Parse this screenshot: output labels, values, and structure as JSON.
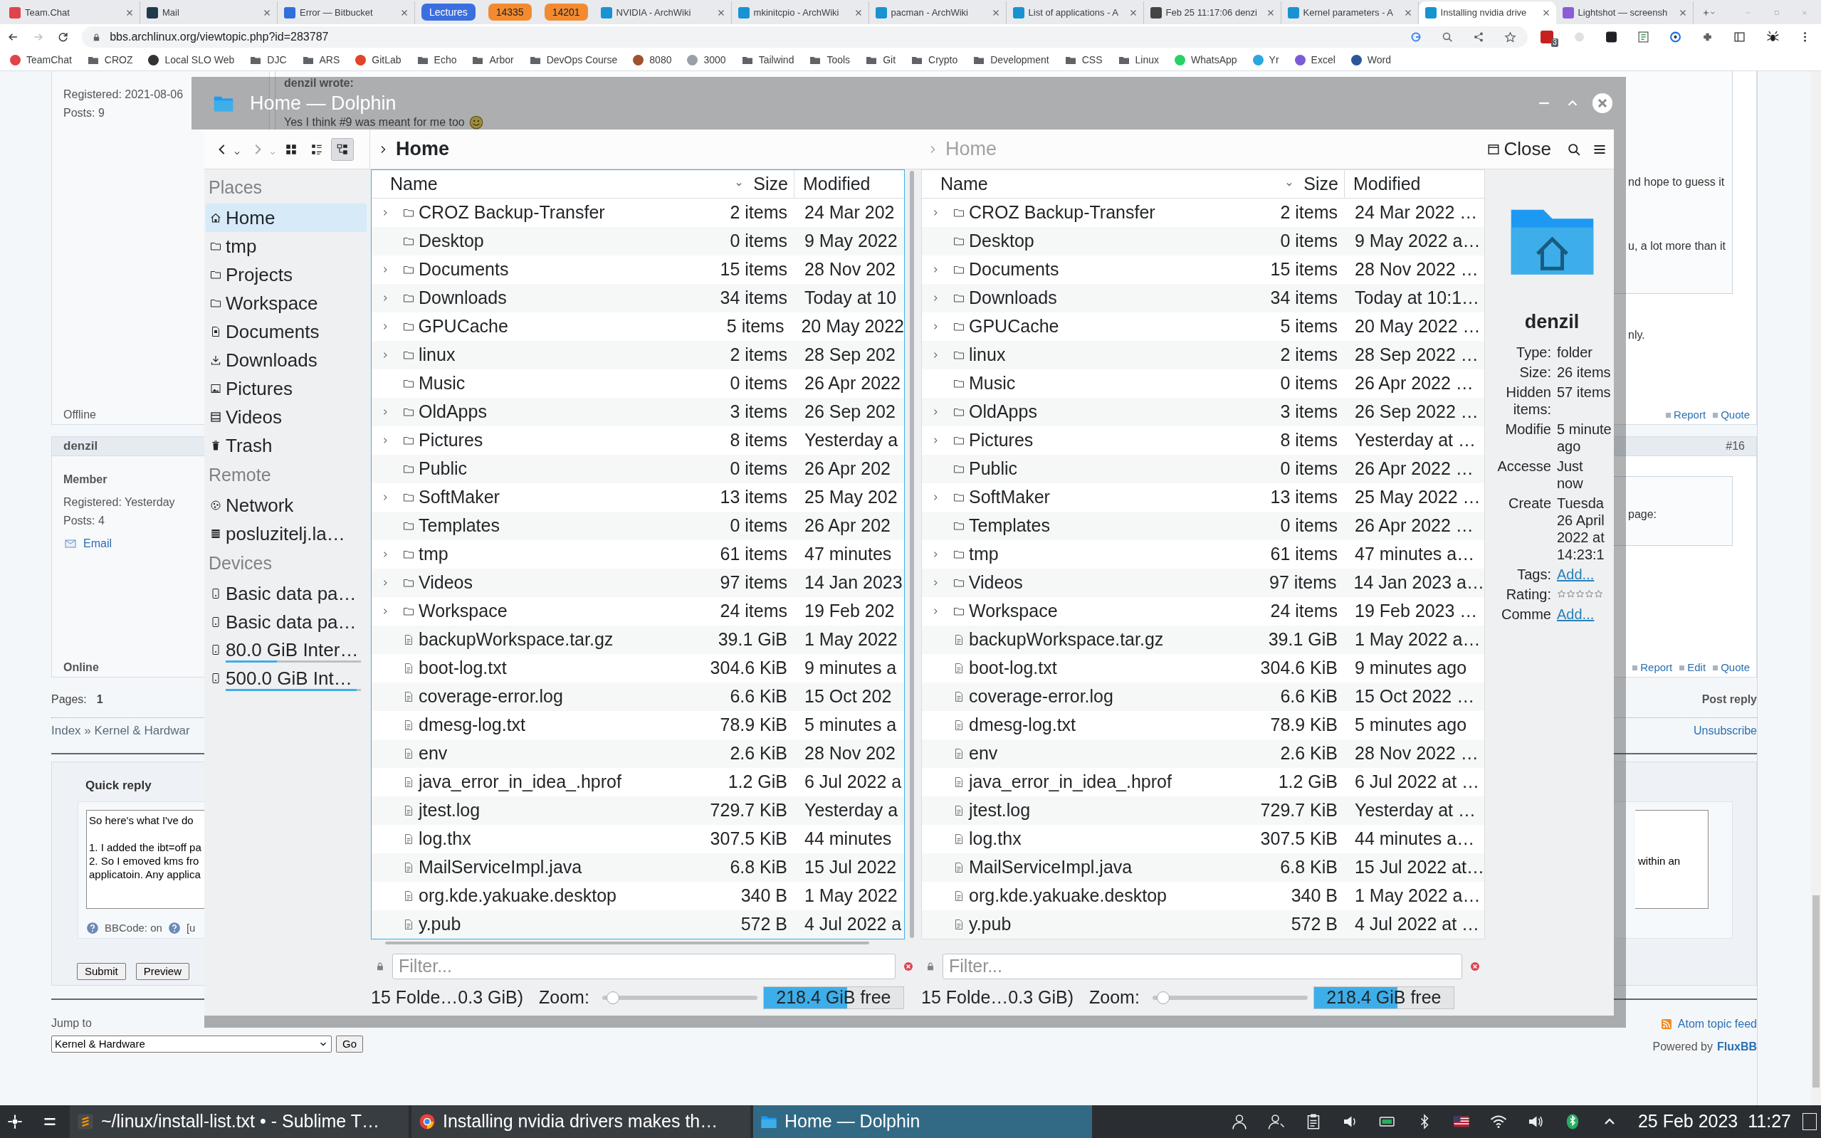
{
  "browser": {
    "tabs": [
      {
        "title": "Team.Chat",
        "kind": "tab",
        "color": "#e0434b",
        "selected": false
      },
      {
        "title": "Mail",
        "kind": "tab",
        "color": "#1f3a4d",
        "selected": false
      },
      {
        "title": "Error — Bitbucket",
        "kind": "tab",
        "color": "#2f6fdb",
        "selected": false
      },
      {
        "title": "Lectures",
        "kind": "group",
        "color": "#3b6fe0"
      },
      {
        "title": "14335",
        "kind": "group",
        "color": "#f28b30"
      },
      {
        "title": "14201",
        "kind": "group",
        "color": "#f28b30"
      },
      {
        "title": "NVIDIA - ArchWiki",
        "kind": "tab",
        "color": "#1793d1",
        "selected": false
      },
      {
        "title": "mkinitcpio - ArchWiki",
        "kind": "tab",
        "color": "#1793d1",
        "selected": false
      },
      {
        "title": "pacman - ArchWiki",
        "kind": "tab",
        "color": "#1793d1",
        "selected": false
      },
      {
        "title": "List of applications - A",
        "kind": "tab",
        "color": "#1793d1",
        "selected": false
      },
      {
        "title": "Feb 25 11:17:06 denzi",
        "kind": "tab",
        "color": "#444444",
        "selected": false
      },
      {
        "title": "Kernel parameters - A",
        "kind": "tab",
        "color": "#1793d1",
        "selected": false
      },
      {
        "title": "Installing nvidia drive",
        "kind": "tab",
        "color": "#1793d1",
        "selected": true
      },
      {
        "title": "Lightshot — screensh",
        "kind": "tab",
        "color": "#8a5cd6",
        "selected": false
      }
    ],
    "address": "bbs.archlinux.org/viewtopic.php?id=283787",
    "extension_badge": "3",
    "bookmarks": [
      {
        "label": "TeamChat",
        "kind": "site",
        "color": "#e0434b"
      },
      {
        "label": "CROZ",
        "kind": "folder"
      },
      {
        "label": "Local SLO Web",
        "kind": "site",
        "color": "#333333"
      },
      {
        "label": "DJC",
        "kind": "folder"
      },
      {
        "label": "ARS",
        "kind": "folder"
      },
      {
        "label": "GitLab",
        "kind": "site",
        "color": "#e24329"
      },
      {
        "label": "Echo",
        "kind": "folder"
      },
      {
        "label": "Arbor",
        "kind": "folder"
      },
      {
        "label": "DevOps Course",
        "kind": "folder"
      },
      {
        "label": "8080",
        "kind": "site",
        "color": "#a0522d"
      },
      {
        "label": "3000",
        "kind": "site",
        "color": "#9aa0a6"
      },
      {
        "label": "Tailwind",
        "kind": "folder"
      },
      {
        "label": "Tools",
        "kind": "folder"
      },
      {
        "label": "Git",
        "kind": "folder"
      },
      {
        "label": "Crypto",
        "kind": "folder"
      },
      {
        "label": "Development",
        "kind": "folder"
      },
      {
        "label": "CSS",
        "kind": "folder"
      },
      {
        "label": "Linux",
        "kind": "folder"
      },
      {
        "label": "WhatsApp",
        "kind": "site",
        "color": "#25d366"
      },
      {
        "label": "Yr",
        "kind": "site",
        "color": "#2aa7e0"
      },
      {
        "label": "Excel",
        "kind": "site",
        "color": "#7b5cd6"
      },
      {
        "label": "Word",
        "kind": "site",
        "color": "#2b579a"
      }
    ]
  },
  "forum": {
    "post1": {
      "registered": "Registered: 2021-08-06",
      "posts": "Posts: 9",
      "status": "Offline",
      "quote_author": "denzil wrote:",
      "quote_text": "Yes I think #9 was meant for me too",
      "quote_tail": [
        "nd hope to guess it",
        "u, a lot more than it"
      ],
      "tail": "nly.",
      "actions": [
        "Report",
        "Quote"
      ]
    },
    "post2": {
      "author": "denzil",
      "number": "#16",
      "rank": "Member",
      "registered": "Registered: Yesterday",
      "posts": "Posts: 4",
      "email": "Email",
      "quote_tail": "page:",
      "status": "Online",
      "actions": [
        "Report",
        "Edit",
        "Quote"
      ]
    },
    "pages_label": "Pages:",
    "page": "1",
    "post_reply": "Post reply",
    "breadcrumb": "Index » Kernel & Hardwar",
    "unsubscribe": "Unsubscribe",
    "quick_reply": {
      "title": "Quick reply",
      "paragraphs": [
        [
          {
            "text": "So here's what I've do"
          }
        ],
        [
          {
            "text": "1. I added the ibt=off pa"
          },
          {
            "text": "2. So I emoved kms fro",
            "end": "within an"
          },
          {
            "text": "applicatoin. Any applica"
          }
        ]
      ],
      "bbcode": "BBCode: on",
      "bbcode_2": "[u",
      "buttons": [
        "Submit",
        "Preview"
      ]
    },
    "jump_label": "Jump to",
    "jump_value": "Kernel & Hardware",
    "go": "Go",
    "feed": "Atom topic feed",
    "powered": "Powered by",
    "powered_link": "FluxBB"
  },
  "dolphin": {
    "title": "Home — Dolphin",
    "view_modes": [
      {
        "selected": false
      },
      {
        "selected": false
      },
      {
        "selected": true
      }
    ],
    "close": "Close",
    "places": [
      {
        "heading": "Places",
        "items": [
          {
            "label": "Home",
            "selected": true
          },
          {
            "label": "tmp",
            "selected": false
          },
          {
            "label": "Projects",
            "selected": false
          },
          {
            "label": "Workspace",
            "selected": false
          },
          {
            "label": "Documents",
            "selected": false
          },
          {
            "label": "Downloads",
            "selected": false
          },
          {
            "label": "Pictures",
            "selected": false
          },
          {
            "label": "Videos",
            "selected": false
          },
          {
            "label": "Trash",
            "selected": false
          }
        ]
      },
      {
        "heading": "Remote",
        "items": [
          {
            "label": "Network",
            "selected": false
          },
          {
            "label": "posluzitelj.la…",
            "selected": false
          }
        ]
      },
      {
        "heading": "Devices",
        "items": [
          {
            "label": "Basic data pa…",
            "selected": false
          },
          {
            "label": "Basic data pa…",
            "selected": false
          },
          {
            "label": "80.0 GiB Inter…",
            "selected": false,
            "level": 0.38
          },
          {
            "label": "500.0 GiB Int…",
            "selected": false,
            "level": 0.97
          }
        ]
      }
    ],
    "panes": [
      {
        "breadcrumb": "Home",
        "active": true,
        "columns": [
          {
            "label": "Name",
            "sorted": false
          },
          {
            "label": "Size",
            "sorted": true
          },
          {
            "label": "Modified",
            "sorted": false
          }
        ],
        "rows": [
          {
            "name": "CROZ Backup-Transfer",
            "size": "2 items",
            "modified": "24 Mar 202",
            "kind": "folder",
            "expandable": true
          },
          {
            "name": "Desktop",
            "size": "0 items",
            "modified": "9 May 2022",
            "kind": "folder",
            "expandable": false
          },
          {
            "name": "Documents",
            "size": "15 items",
            "modified": "28 Nov 202",
            "kind": "folder",
            "expandable": true
          },
          {
            "name": "Downloads",
            "size": "34 items",
            "modified": "Today at 10",
            "kind": "folder",
            "expandable": true
          },
          {
            "name": "GPUCache",
            "size": "5 items",
            "modified": "20 May 2022",
            "kind": "folder",
            "expandable": true
          },
          {
            "name": "linux",
            "size": "2 items",
            "modified": "28 Sep 202",
            "kind": "folder",
            "expandable": true
          },
          {
            "name": "Music",
            "size": "0 items",
            "modified": "26 Apr 2022",
            "kind": "folder",
            "expandable": false
          },
          {
            "name": "OldApps",
            "size": "3 items",
            "modified": "26 Sep 202",
            "kind": "folder",
            "expandable": true
          },
          {
            "name": "Pictures",
            "size": "8 items",
            "modified": "Yesterday a",
            "kind": "folder",
            "expandable": true
          },
          {
            "name": "Public",
            "size": "0 items",
            "modified": "26 Apr 202",
            "kind": "folder",
            "expandable": false
          },
          {
            "name": "SoftMaker",
            "size": "13 items",
            "modified": "25 May 202",
            "kind": "folder",
            "expandable": true
          },
          {
            "name": "Templates",
            "size": "0 items",
            "modified": "26 Apr 202",
            "kind": "folder",
            "expandable": false
          },
          {
            "name": "tmp",
            "size": "61 items",
            "modified": "47 minutes",
            "kind": "folder",
            "expandable": true
          },
          {
            "name": "Videos",
            "size": "97 items",
            "modified": "14 Jan 2023",
            "kind": "folder",
            "expandable": true
          },
          {
            "name": "Workspace",
            "size": "24 items",
            "modified": "19 Feb 202",
            "kind": "folder",
            "expandable": true
          },
          {
            "name": "backupWorkspace.tar.gz",
            "size": "39.1 GiB",
            "modified": "1 May 2022",
            "kind": "file",
            "expandable": false
          },
          {
            "name": "boot-log.txt",
            "size": "304.6 KiB",
            "modified": "9 minutes a",
            "kind": "file",
            "expandable": false
          },
          {
            "name": "coverage-error.log",
            "size": "6.6 KiB",
            "modified": "15 Oct 202",
            "kind": "file",
            "expandable": false
          },
          {
            "name": "dmesg-log.txt",
            "size": "78.9 KiB",
            "modified": "5 minutes a",
            "kind": "file",
            "expandable": false
          },
          {
            "name": "env",
            "size": "2.6 KiB",
            "modified": "28 Nov 202",
            "kind": "file",
            "expandable": false
          },
          {
            "name": "java_error_in_idea_.hprof",
            "size": "1.2 GiB",
            "modified": "6 Jul 2022 a",
            "kind": "file",
            "expandable": false
          },
          {
            "name": "jtest.log",
            "size": "729.7 KiB",
            "modified": "Yesterday a",
            "kind": "file",
            "expandable": false
          },
          {
            "name": "log.thx",
            "size": "307.5 KiB",
            "modified": "44 minutes",
            "kind": "file",
            "expandable": false
          },
          {
            "name": "MailServiceImpl.java",
            "size": "6.8 KiB",
            "modified": "15 Jul 2022",
            "kind": "file",
            "expandable": false
          },
          {
            "name": "org.kde.yakuake.desktop",
            "size": "340 B",
            "modified": "1 May 2022",
            "kind": "file",
            "expandable": false
          },
          {
            "name": "y.pub",
            "size": "572 B",
            "modified": "4 Jul 2022 a",
            "kind": "file",
            "expandable": false
          }
        ],
        "filter_placeholder": "Filter...",
        "summary": "15 Folde…0.3 GiB)",
        "zoom": {
          "label": "Zoom:",
          "level": 0.03
        },
        "free": {
          "text": "218.4 GiB free",
          "level": 0.6
        }
      },
      {
        "breadcrumb": "Home",
        "active": false,
        "columns": [
          {
            "label": "Name",
            "sorted": false
          },
          {
            "label": "Size",
            "sorted": true
          },
          {
            "label": "Modified",
            "sorted": false
          }
        ],
        "rows": [
          {
            "name": "CROZ Backup-Transfer",
            "size": "2 items",
            "modified": "24 Mar 2022 …",
            "kind": "folder",
            "expandable": true
          },
          {
            "name": "Desktop",
            "size": "0 items",
            "modified": "9 May 2022 a…",
            "kind": "folder",
            "expandable": false
          },
          {
            "name": "Documents",
            "size": "15 items",
            "modified": "28 Nov 2022 …",
            "kind": "folder",
            "expandable": true
          },
          {
            "name": "Downloads",
            "size": "34 items",
            "modified": "Today at 10:1…",
            "kind": "folder",
            "expandable": true
          },
          {
            "name": "GPUCache",
            "size": "5 items",
            "modified": "20 May 2022 …",
            "kind": "folder",
            "expandable": true
          },
          {
            "name": "linux",
            "size": "2 items",
            "modified": "28 Sep 2022 …",
            "kind": "folder",
            "expandable": true
          },
          {
            "name": "Music",
            "size": "0 items",
            "modified": "26 Apr 2022 …",
            "kind": "folder",
            "expandable": false
          },
          {
            "name": "OldApps",
            "size": "3 items",
            "modified": "26 Sep 2022 …",
            "kind": "folder",
            "expandable": true
          },
          {
            "name": "Pictures",
            "size": "8 items",
            "modified": "Yesterday at …",
            "kind": "folder",
            "expandable": true
          },
          {
            "name": "Public",
            "size": "0 items",
            "modified": "26 Apr 2022 …",
            "kind": "folder",
            "expandable": false
          },
          {
            "name": "SoftMaker",
            "size": "13 items",
            "modified": "25 May 2022 …",
            "kind": "folder",
            "expandable": true
          },
          {
            "name": "Templates",
            "size": "0 items",
            "modified": "26 Apr 2022 …",
            "kind": "folder",
            "expandable": false
          },
          {
            "name": "tmp",
            "size": "61 items",
            "modified": "47 minutes a…",
            "kind": "folder",
            "expandable": true
          },
          {
            "name": "Videos",
            "size": "97 items",
            "modified": "14 Jan 2023 a…",
            "kind": "folder",
            "expandable": true
          },
          {
            "name": "Workspace",
            "size": "24 items",
            "modified": "19 Feb 2023 …",
            "kind": "folder",
            "expandable": true
          },
          {
            "name": "backupWorkspace.tar.gz",
            "size": "39.1 GiB",
            "modified": "1 May 2022 a…",
            "kind": "file",
            "expandable": false
          },
          {
            "name": "boot-log.txt",
            "size": "304.6 KiB",
            "modified": "9 minutes ago",
            "kind": "file",
            "expandable": false
          },
          {
            "name": "coverage-error.log",
            "size": "6.6 KiB",
            "modified": "15 Oct 2022 …",
            "kind": "file",
            "expandable": false
          },
          {
            "name": "dmesg-log.txt",
            "size": "78.9 KiB",
            "modified": "5 minutes ago",
            "kind": "file",
            "expandable": false
          },
          {
            "name": "env",
            "size": "2.6 KiB",
            "modified": "28 Nov 2022 …",
            "kind": "file",
            "expandable": false
          },
          {
            "name": "java_error_in_idea_.hprof",
            "size": "1.2 GiB",
            "modified": "6 Jul 2022 at …",
            "kind": "file",
            "expandable": false
          },
          {
            "name": "jtest.log",
            "size": "729.7 KiB",
            "modified": "Yesterday at …",
            "kind": "file",
            "expandable": false
          },
          {
            "name": "log.thx",
            "size": "307.5 KiB",
            "modified": "44 minutes a…",
            "kind": "file",
            "expandable": false
          },
          {
            "name": "MailServiceImpl.java",
            "size": "6.8 KiB",
            "modified": "15 Jul 2022 at…",
            "kind": "file",
            "expandable": false
          },
          {
            "name": "org.kde.yakuake.desktop",
            "size": "340 B",
            "modified": "1 May 2022 a…",
            "kind": "file",
            "expandable": false
          },
          {
            "name": "y.pub",
            "size": "572 B",
            "modified": "4 Jul 2022 at …",
            "kind": "file",
            "expandable": false
          }
        ],
        "filter_placeholder": "Filter...",
        "summary": "15 Folde…0.3 GiB)",
        "zoom": {
          "label": "Zoom:",
          "level": 0.03
        },
        "free": {
          "text": "218.4 GiB free",
          "level": 0.6
        }
      }
    ],
    "info": {
      "name": "denzil",
      "fields": [
        {
          "label": "Type:",
          "value": "folder",
          "kind": "text"
        },
        {
          "label": "Size:",
          "value": "26 items",
          "kind": "text"
        },
        {
          "label": "Hidden items:",
          "value": "57 items",
          "kind": "text"
        },
        {
          "label": "Modifie",
          "value": "5 minute ago",
          "kind": "text"
        },
        {
          "label": "Accesse",
          "value": "Just now",
          "kind": "text"
        },
        {
          "label": "Create",
          "value": "Tuesda 26 April 2022 at 14:23:1",
          "kind": "text"
        },
        {
          "label": "Tags:",
          "value": "Add...",
          "kind": "link"
        },
        {
          "label": "Rating:",
          "stars": 0,
          "kind": "rating"
        },
        {
          "label": "Comme",
          "value": "Add...",
          "kind": "link"
        }
      ]
    }
  },
  "taskbar": {
    "tasks": [
      {
        "label": "~/linux/install-list.txt • - Sublime T…",
        "selected": false
      },
      {
        "label": "Installing nvidia drivers makes th…",
        "selected": false
      },
      {
        "label": "Home — Dolphin",
        "selected": true
      }
    ],
    "date": "25 Feb 2023",
    "time": "11:27"
  }
}
